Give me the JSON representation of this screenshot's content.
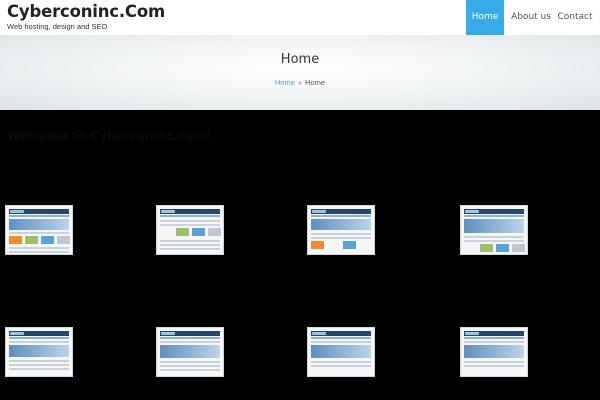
{
  "header": {
    "site_title": "Cyberconinc.Com",
    "tagline": "Web hosting, design and SEO",
    "nav": [
      {
        "label": "Home"
      },
      {
        "label": "About us"
      },
      {
        "label": "Contact"
      }
    ]
  },
  "hero": {
    "page_title": "Home",
    "breadcrumb": [
      {
        "label": "Home"
      },
      {
        "label": "Home"
      }
    ],
    "separator": "»"
  },
  "main": {
    "welcome_heading": "Welcome to Cyberconinc.com!",
    "intro": "",
    "subhead": "",
    "portfolio": [
      {
        "link": "",
        "text": ""
      },
      {
        "link": "",
        "text": ""
      },
      {
        "link": "",
        "text": ""
      },
      {
        "link": "",
        "text": ""
      },
      {
        "link": "",
        "text": ""
      },
      {
        "link": "",
        "text": ""
      },
      {
        "link": "",
        "text": ""
      },
      {
        "link": "",
        "text": ""
      }
    ]
  },
  "colors": {
    "accent": "#37abe8",
    "header_bg": "#ffffff",
    "body_bg": "#000000"
  }
}
